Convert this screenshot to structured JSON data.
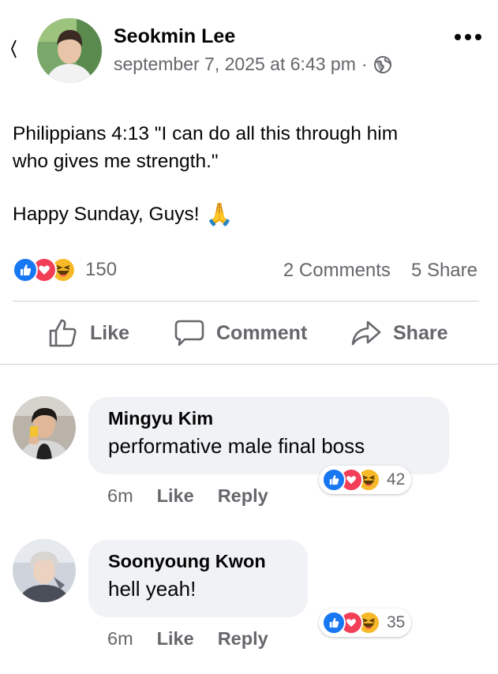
{
  "post": {
    "author": "Seokmin Lee",
    "timestamp": "september 7, 2025 at 6:43 pm",
    "separator": "·",
    "privacy_icon": "globe-icon",
    "text_line1": "Philippians 4:13 \"I can do all this through him",
    "text_line2": "who gives me strength.\"",
    "text_line3": "Happy Sunday, Guys!",
    "emoji": "🙏",
    "reactions": [
      "like-icon",
      "love-icon",
      "haha-icon"
    ],
    "reaction_count": "150",
    "comments_count": "2 Comments",
    "share_count": "5 Share"
  },
  "actions": {
    "like": "Like",
    "comment": "Comment",
    "share": "Share"
  },
  "comments": [
    {
      "author": "Mingyu Kim",
      "text": "performative male final boss",
      "time": "6m",
      "like": "Like",
      "reply": "Reply",
      "reaction_count": "42"
    },
    {
      "author": "Soonyoung Kwon",
      "text": "hell yeah!",
      "time": "6m",
      "like": "Like",
      "reply": "Reply",
      "reaction_count": "35"
    }
  ],
  "colors": {
    "like_blue": "#1877f2",
    "love_red": "#f33e58",
    "haha_yellow": "#f7b928",
    "muted_text": "#65676b",
    "bubble_bg": "#f0f2f5"
  }
}
